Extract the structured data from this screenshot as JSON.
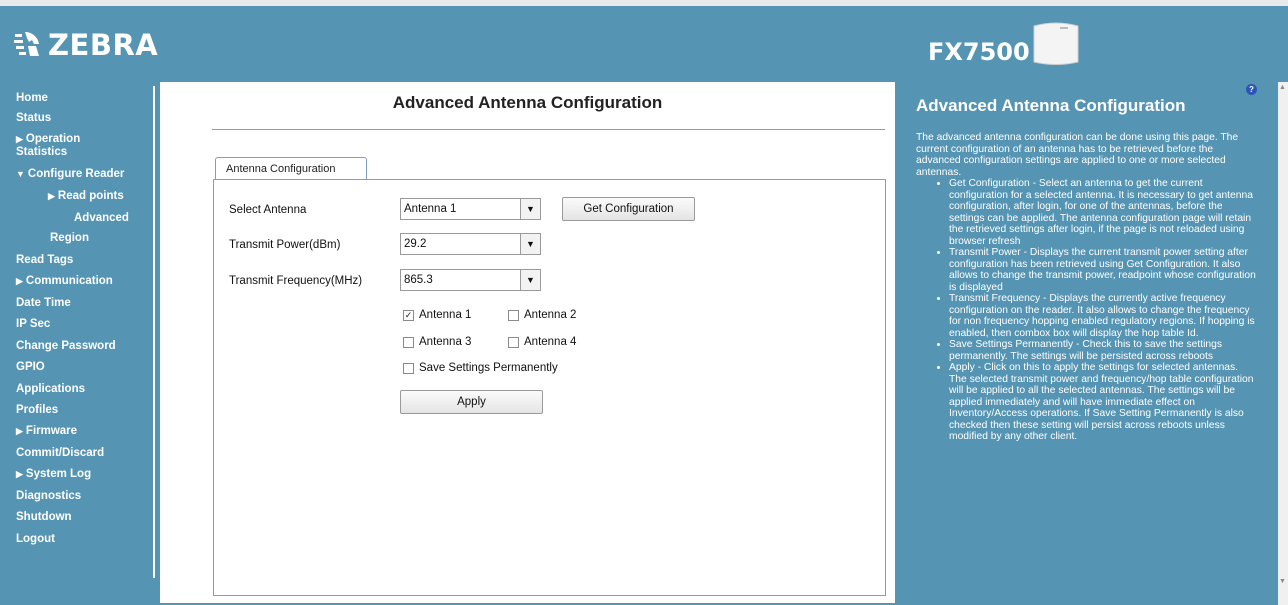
{
  "header": {
    "brand": "ZEBRA",
    "model": "FX7500"
  },
  "nav": {
    "items": [
      {
        "label": "Home"
      },
      {
        "label": "Status"
      },
      {
        "label": "Operation",
        "arrow": "▶"
      },
      {
        "label": "Statistics"
      },
      {
        "label": "Configure Reader",
        "arrow": "▼"
      },
      {
        "label": "Read points",
        "arrow": "▶"
      },
      {
        "label": "Advanced"
      },
      {
        "label": "Region"
      },
      {
        "label": "Read Tags"
      },
      {
        "label": "Communication",
        "arrow": "▶"
      },
      {
        "label": "Date Time"
      },
      {
        "label": "IP Sec"
      },
      {
        "label": "Change Password"
      },
      {
        "label": "GPIO"
      },
      {
        "label": "Applications"
      },
      {
        "label": "Profiles"
      },
      {
        "label": "Firmware",
        "arrow": "▶"
      },
      {
        "label": "Commit/Discard"
      },
      {
        "label": "System Log",
        "arrow": "▶"
      },
      {
        "label": "Diagnostics"
      },
      {
        "label": "Shutdown"
      },
      {
        "label": "Logout"
      }
    ]
  },
  "main": {
    "title": "Advanced Antenna Configuration",
    "tab_label": "Antenna Configuration",
    "select_antenna_label": "Select Antenna",
    "select_antenna_value": "Antenna 1",
    "get_config_button": "Get Configuration",
    "transmit_power_label": "Transmit Power(dBm)",
    "transmit_power_value": "29.2",
    "transmit_freq_label": "Transmit Frequency(MHz)",
    "transmit_freq_value": "865.3",
    "checkboxes": [
      {
        "label": "Antenna 1",
        "checked": true
      },
      {
        "label": "Antenna 2",
        "checked": false
      },
      {
        "label": "Antenna 3",
        "checked": false
      },
      {
        "label": "Antenna 4",
        "checked": false
      }
    ],
    "save_permanently_label": "Save Settings Permanently",
    "apply_button": "Apply",
    "dropdown_glyph": "▼",
    "check_glyph": "✓"
  },
  "help": {
    "icon_glyph": "?",
    "title": "Advanced Antenna Configuration",
    "intro": "The advanced antenna configuration can be done using this page. The current configuration of an antenna has to be retrieved before the advanced configuration settings are applied to one or more selected antennas.",
    "bullets": [
      "Get Configuration - Select an antenna to get the current configuration for a selected antenna. It is necessary to get antenna configuration, after login, for one of the antennas, before the settings can be applied. The antenna configuration page will retain the retrieved settings after login, if the page is not reloaded using browser refresh",
      "Transmit Power - Displays the current transmit power setting after configuration has been retrieved using Get Configuration. It also allows to change the transmit power, readpoint whose configuration is displayed",
      "Transmit Frequency - Displays the currently active frequency configuration on the reader. It also allows to change the frequency for non frequency hopping enabled regulatory regions. If hopping is enabled, then combox box will display the hop table Id.",
      "Save Settings Permanently - Check this to save the settings permanently. The settings will be persisted across reboots",
      "Apply - Click on this to apply the settings for selected antennas. The selected transmit power and frequency/hop table configuration will be applied to all the selected antennas. The settings will be applied immediately and will have immediate effect on Inventory/Access operations. If Save Setting Permanently is also checked then these setting will persist across reboots unless modified by any other client."
    ]
  },
  "scroll": {
    "up": "▲",
    "down": "▼"
  }
}
